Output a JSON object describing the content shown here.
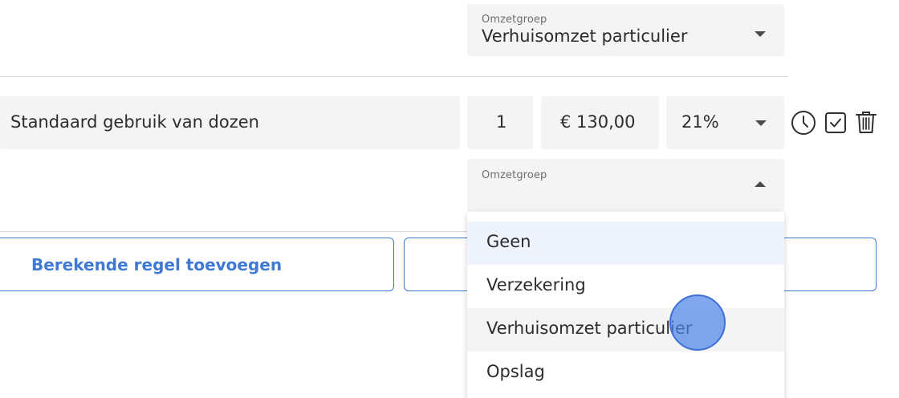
{
  "top_select": {
    "label": "Omzetgroep",
    "value": "Verhuisomzet particulier"
  },
  "line_item": {
    "description": "Standaard gebruik van dozen",
    "quantity": "1",
    "price": "€ 130,00",
    "vat": "21%"
  },
  "open_select": {
    "label": "Omzetgroep",
    "value": ""
  },
  "dropdown": {
    "options": [
      "Geen",
      "Verzekering",
      "Verhuisomzet particulier",
      "Opslag"
    ],
    "highlighted_index": 0,
    "hovered_index": 2
  },
  "buttons": {
    "add_calculated_line": "Berekende regel toevoegen",
    "second_button": ""
  },
  "icons": [
    "clock-icon",
    "checkbox-icon",
    "trash-icon"
  ],
  "colors": {
    "accent": "#3f79d1",
    "field_bg": "#f4f4f4",
    "menu_highlight": "#eef3fc",
    "menu_hover": "#f4f4f4"
  }
}
